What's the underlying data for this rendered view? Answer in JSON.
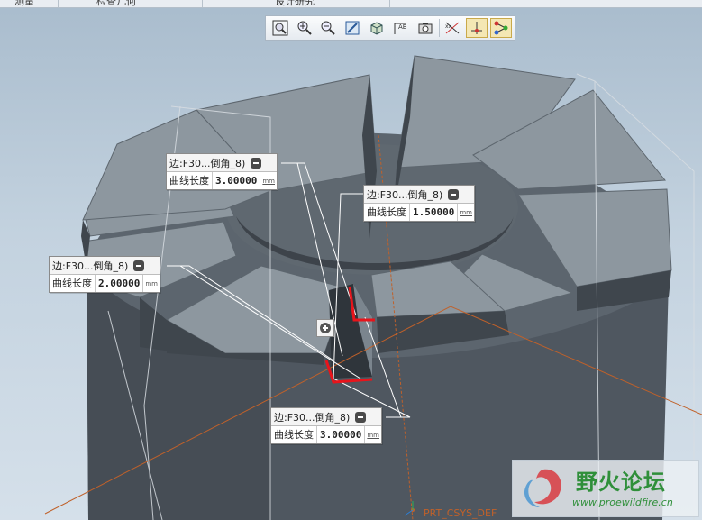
{
  "topbar": {
    "tabs": [
      {
        "label": "测量"
      },
      {
        "label": "检查几何"
      },
      {
        "label": "设计研究"
      }
    ]
  },
  "view_toolbar": {
    "buttons": [
      {
        "icon": "zoom-fit-icon",
        "active": false
      },
      {
        "icon": "zoom-in-icon",
        "active": false
      },
      {
        "icon": "zoom-out-icon",
        "active": false
      },
      {
        "icon": "repaint-icon",
        "active": false
      },
      {
        "icon": "display-style-icon",
        "active": false
      },
      {
        "icon": "saved-views-icon",
        "active": false
      },
      {
        "icon": "view-manager-icon",
        "active": false
      },
      {
        "icon": "datum-display-icon",
        "active": false
      },
      {
        "icon": "spin-center-icon",
        "active": true
      },
      {
        "icon": "annotation-display-icon",
        "active": true
      }
    ]
  },
  "callouts": [
    {
      "title": "边:F30...倒角_8)",
      "label": "曲线长度",
      "value": "3.00000",
      "unit": "mm"
    },
    {
      "title": "边:F30...倒角_8)",
      "label": "曲线长度",
      "value": "1.50000",
      "unit": "mm"
    },
    {
      "title": "边:F30...倒角_8)",
      "label": "曲线长度",
      "value": "2.00000",
      "unit": "mm"
    },
    {
      "title": "边:F30...倒角_8)",
      "label": "曲线长度",
      "value": "3.00000",
      "unit": "mm"
    }
  ],
  "csys_label": "PRT_CSYS_DEF",
  "watermark": {
    "title": "野火论坛",
    "url": "www.proewildfire.cn"
  },
  "colors": {
    "model_top": "#8d979f",
    "model_side": "#4f5760",
    "highlight": "#e8141b",
    "csys": "#c0612a"
  }
}
